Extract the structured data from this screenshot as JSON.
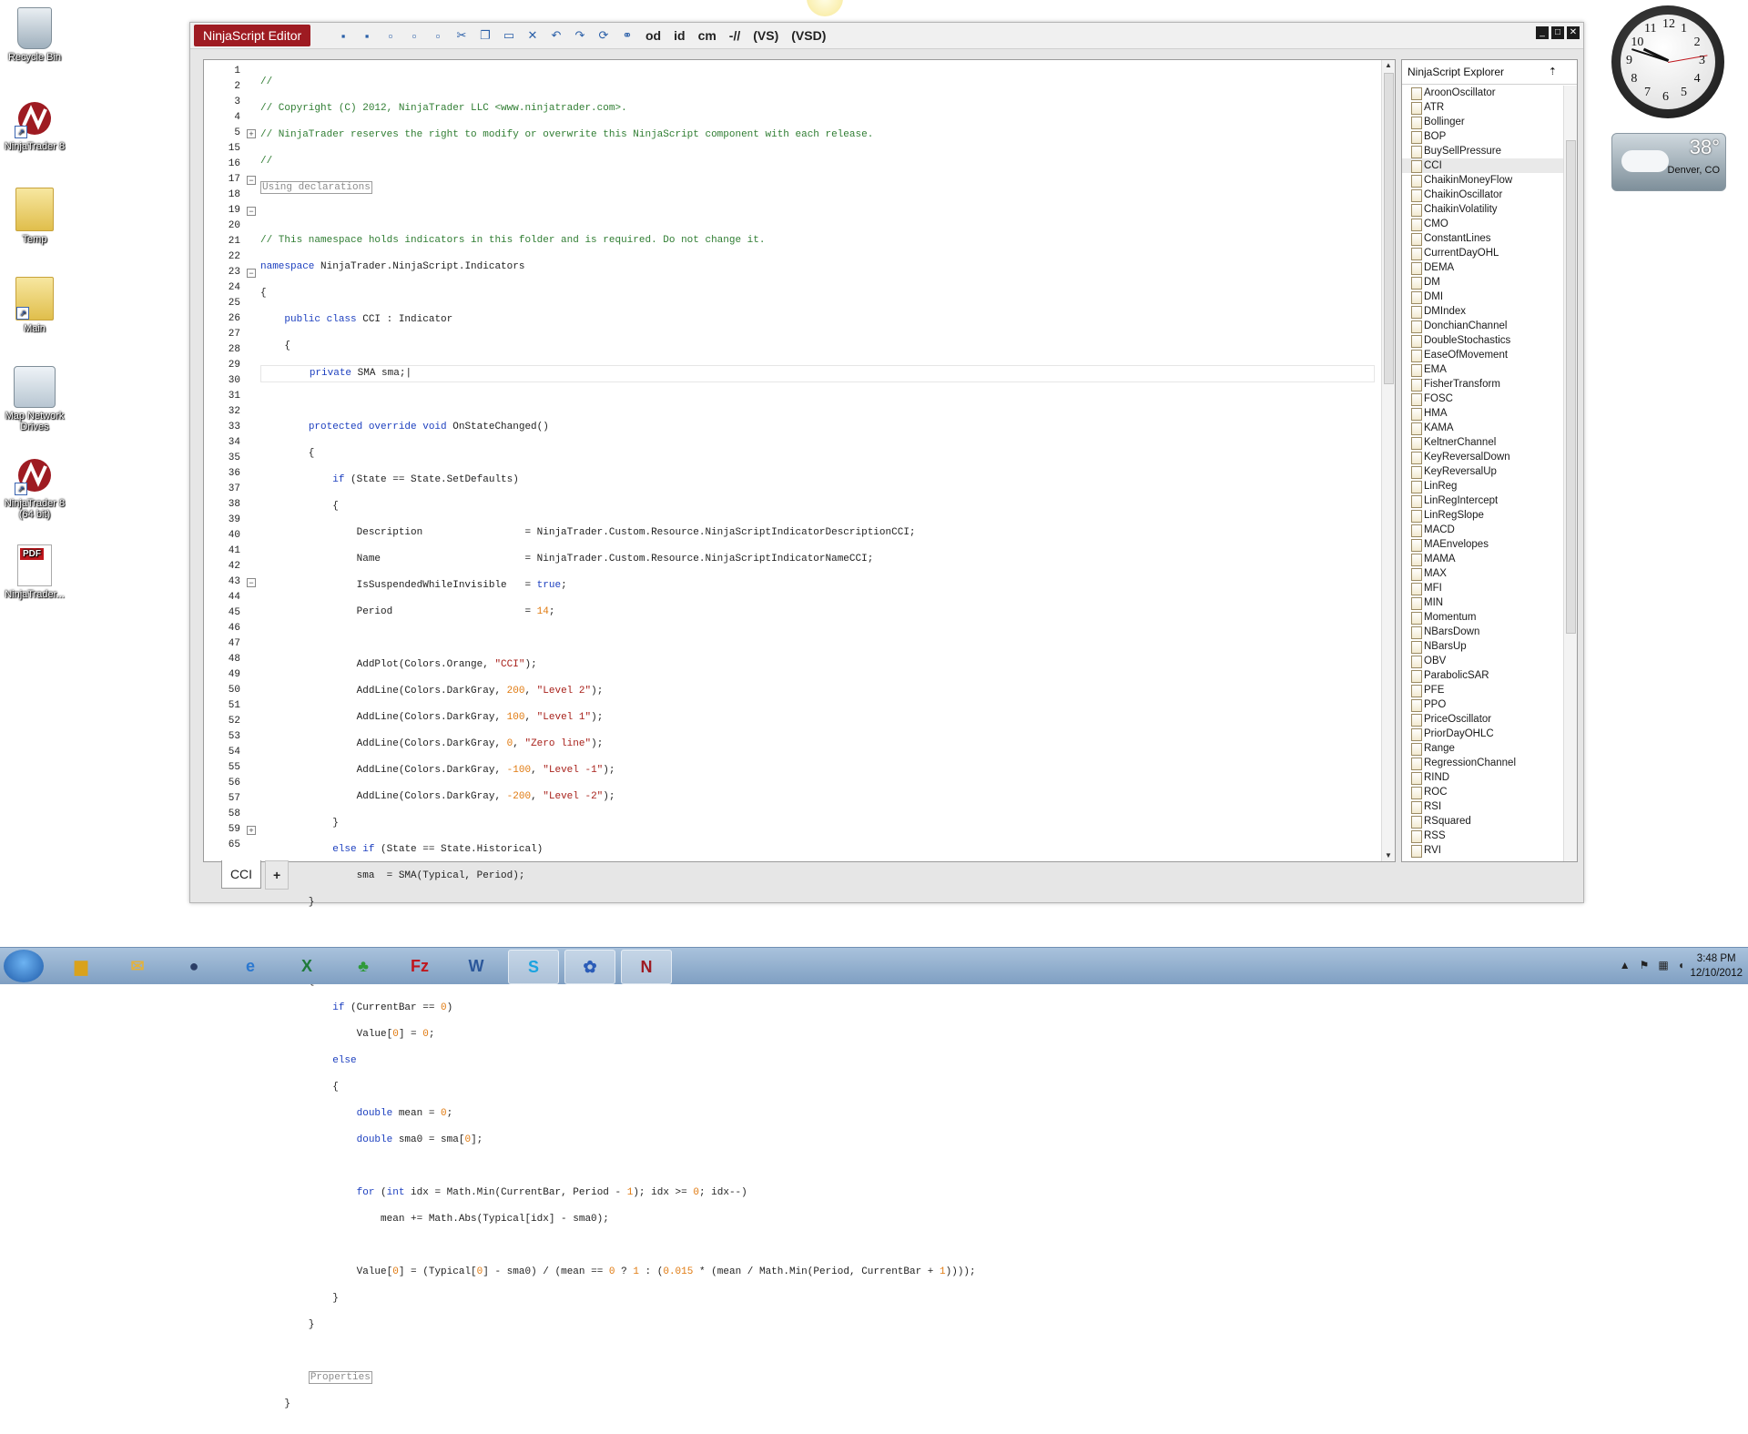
{
  "desktop": {
    "icons": [
      {
        "label": "Recycle Bin"
      },
      {
        "label": "NinjaTrader 8"
      },
      {
        "label": "Temp"
      },
      {
        "label": "Main"
      },
      {
        "label": "Map Network Drives"
      },
      {
        "label": "NinjaTrader 8 (64 bit)"
      },
      {
        "label": "NinjaTrader..."
      }
    ]
  },
  "editor": {
    "title": "NinjaScript Editor",
    "toolbar_text": [
      "od",
      "id",
      "cm",
      "-//",
      "(VS)",
      "(VSD)"
    ],
    "tabs": [
      {
        "label": "CCI"
      },
      {
        "label": "+"
      }
    ],
    "line_numbers": [
      "1",
      "2",
      "3",
      "4",
      "5",
      "15",
      "16",
      "17",
      "18",
      "19",
      "20",
      "21",
      "22",
      "23",
      "24",
      "25",
      "26",
      "27",
      "28",
      "29",
      "30",
      "31",
      "32",
      "33",
      "34",
      "35",
      "36",
      "37",
      "38",
      "39",
      "40",
      "41",
      "42",
      "43",
      "44",
      "45",
      "46",
      "47",
      "48",
      "49",
      "50",
      "51",
      "52",
      "53",
      "54",
      "55",
      "56",
      "57",
      "58",
      "59",
      "65"
    ],
    "collapsed_using": "Using declarations",
    "collapsed_properties": "Properties"
  },
  "explorer": {
    "title": "NinjaScript Explorer",
    "selected": "CCI",
    "items": [
      "AroonOscillator",
      "ATR",
      "Bollinger",
      "BOP",
      "BuySellPressure",
      "CCI",
      "ChaikinMoneyFlow",
      "ChaikinOscillator",
      "ChaikinVolatility",
      "CMO",
      "ConstantLines",
      "CurrentDayOHL",
      "DEMA",
      "DM",
      "DMI",
      "DMIndex",
      "DonchianChannel",
      "DoubleStochastics",
      "EaseOfMovement",
      "EMA",
      "FisherTransform",
      "FOSC",
      "HMA",
      "KAMA",
      "KeltnerChannel",
      "KeyReversalDown",
      "KeyReversalUp",
      "LinReg",
      "LinRegIntercept",
      "LinRegSlope",
      "MACD",
      "MAEnvelopes",
      "MAMA",
      "MAX",
      "MFI",
      "MIN",
      "Momentum",
      "NBarsDown",
      "NBarsUp",
      "OBV",
      "ParabolicSAR",
      "PFE",
      "PPO",
      "PriceOscillator",
      "PriorDayOHLC",
      "Range",
      "RegressionChannel",
      "RIND",
      "ROC",
      "RSI",
      "RSquared",
      "RSS",
      "RVI"
    ]
  },
  "gadgets": {
    "clock_numbers": [
      "12",
      "1",
      "2",
      "3",
      "4",
      "5",
      "6",
      "7",
      "8",
      "9",
      "10",
      "11"
    ],
    "weather_temp": "38°",
    "weather_location": "Denver, CO"
  },
  "taskbar": {
    "time": "3:48 PM",
    "date": "12/10/2012"
  }
}
